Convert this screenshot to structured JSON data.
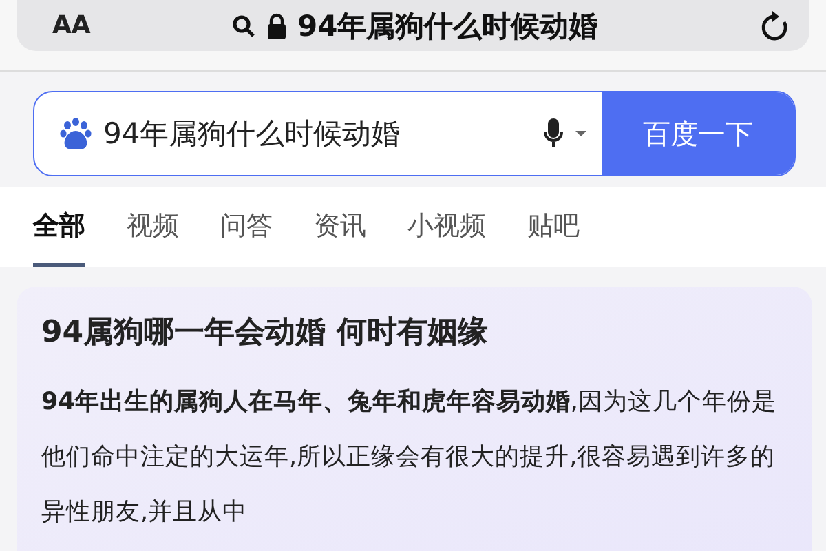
{
  "address_bar": {
    "text_size": "AA",
    "url": "94年属狗什么时候动婚"
  },
  "search": {
    "value": "94年属狗什么时候动婚",
    "button": "百度一下"
  },
  "tabs": [
    {
      "label": "全部",
      "selected": true
    },
    {
      "label": "视频",
      "selected": false
    },
    {
      "label": "问答",
      "selected": false
    },
    {
      "label": "资讯",
      "selected": false
    },
    {
      "label": "小视频",
      "selected": false
    },
    {
      "label": "贴吧",
      "selected": false
    }
  ],
  "result": {
    "title": "94属狗哪一年会动婚 何时有姻缘",
    "body": "**94年出生的属狗人在马年、兔年和虎年容易动婚**,因为这几个年份是他们命中注定的大运年,所以正缘会有很大的提升,很容易遇到许多的异性朋友,并且从中"
  }
}
